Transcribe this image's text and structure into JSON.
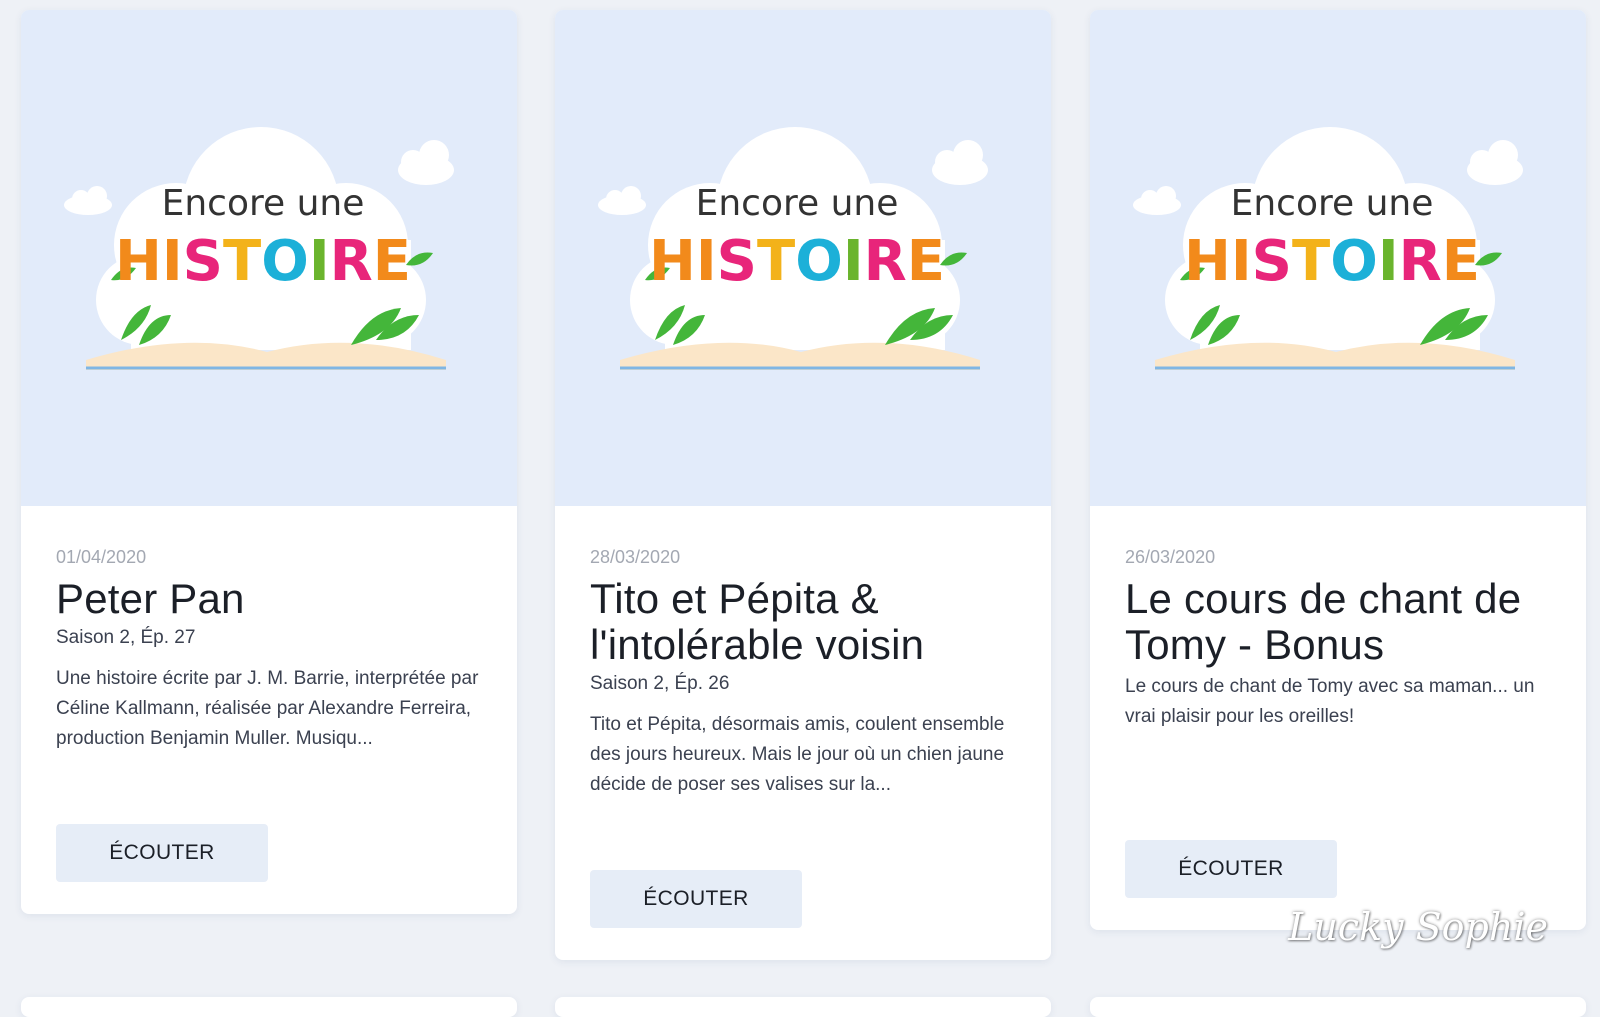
{
  "episodes": [
    {
      "date": "01/04/2020",
      "title": "Peter Pan",
      "episode": "Saison 2, Ép. 27",
      "description": "Une histoire écrite par J. M. Barrie, interprétée par Céline Kallmann, réalisée par Alexandre Ferreira, production Benjamin Muller. Musiqu...",
      "button_label": "ÉCOUTER",
      "cover": {
        "top_text": "Encore une",
        "main_text": "HISTOIRE"
      }
    },
    {
      "date": "28/03/2020",
      "title": "Tito et Pépita & l'intolérable voisin",
      "episode": "Saison 2, Ép. 26",
      "description": "Tito et Pépita, désormais amis, coulent ensemble des jours heureux. Mais le jour où un chien jaune décide de poser ses valises sur la...",
      "button_label": "ÉCOUTER",
      "cover": {
        "top_text": "Encore une",
        "main_text": "HISTOIRE"
      }
    },
    {
      "date": "26/03/2020",
      "title": "Le cours de chant de Tomy - Bonus",
      "episode": "",
      "description": "Le cours de chant de Tomy avec sa maman... un vrai plaisir pour les oreilles!",
      "button_label": "ÉCOUTER",
      "cover": {
        "top_text": "Encore une",
        "main_text": "HISTOIRE"
      }
    }
  ],
  "watermark": "Lucky Sophie",
  "colors": {
    "background": "#eef1f6",
    "cover_background": "#e2ebfa",
    "button_background": "#e6edf7",
    "letters": [
      "#f28a1b",
      "#f28a1b",
      "#e8257a",
      "#f3b21a",
      "#1cb0d8",
      "#6ab42d",
      "#e8257a",
      "#f28a1b"
    ]
  }
}
